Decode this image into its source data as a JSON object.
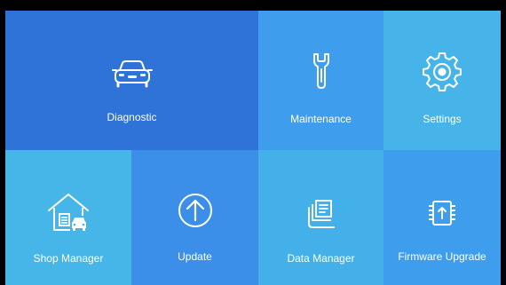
{
  "tiles": [
    {
      "id": "diagnostic",
      "label": "Diagnostic",
      "icon": "car-icon",
      "color": "#2f72d8"
    },
    {
      "id": "maintenance",
      "label": "Maintenance",
      "icon": "wrench-icon",
      "color": "#3f9ded"
    },
    {
      "id": "settings",
      "label": "Settings",
      "icon": "gear-icon",
      "color": "#46b4e9"
    },
    {
      "id": "shop_manager",
      "label": "Shop Manager",
      "icon": "house-car-icon",
      "color": "#46b6e9"
    },
    {
      "id": "update",
      "label": "Update",
      "icon": "arrow-up-circle-icon",
      "color": "#3b8fe8"
    },
    {
      "id": "data_manager",
      "label": "Data Manager",
      "icon": "document-stack-icon",
      "color": "#43b0ea"
    },
    {
      "id": "firmware_upgrade",
      "label": "Firmware Upgrade",
      "icon": "chip-upgrade-icon",
      "color": "#3f9ded"
    }
  ]
}
